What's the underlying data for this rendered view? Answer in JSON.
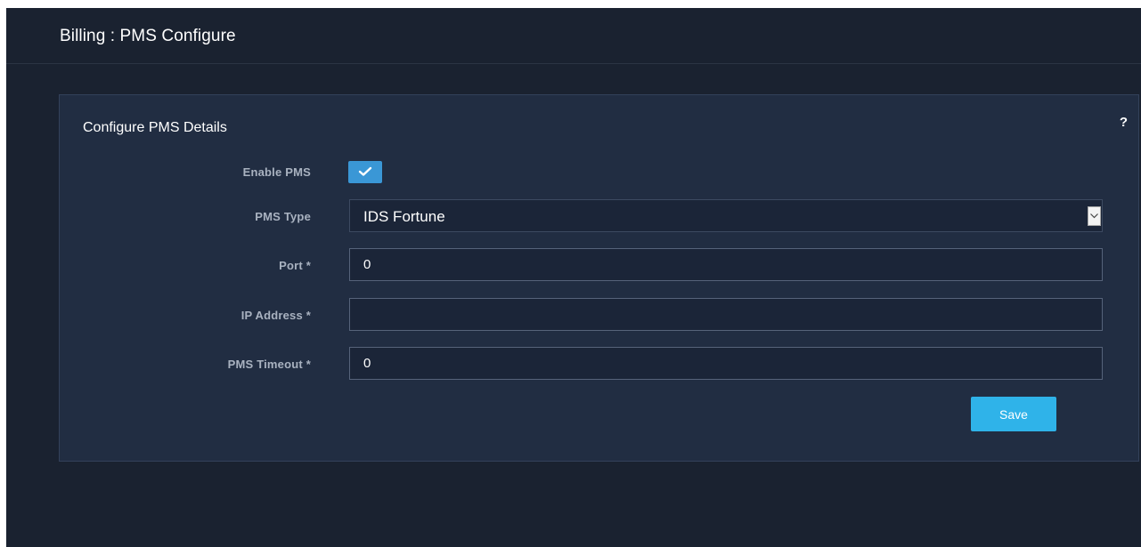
{
  "header": {
    "title": "Billing : PMS Configure"
  },
  "panel": {
    "title": "Configure PMS Details",
    "help_icon": "?"
  },
  "form": {
    "enable_pms": {
      "label": "Enable PMS",
      "checked": true
    },
    "pms_type": {
      "label": "PMS Type",
      "value": "IDS Fortune"
    },
    "port": {
      "label": "Port *",
      "value": "0"
    },
    "ip_address": {
      "label": "IP Address *",
      "value": ""
    },
    "pms_timeout": {
      "label": "PMS Timeout *",
      "value": "0"
    },
    "save_label": "Save"
  },
  "colors": {
    "background": "#1a2230",
    "panel": "#212d42",
    "accent_checkbox": "#3a97d6",
    "accent_button": "#2fb3e9"
  },
  "icons": {
    "checkbox": "check-icon",
    "select": "chevron-down-icon",
    "help": "help-icon"
  }
}
